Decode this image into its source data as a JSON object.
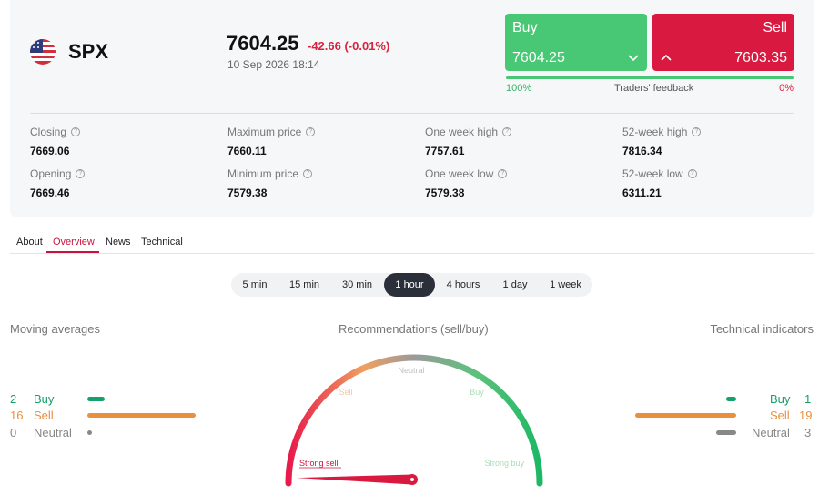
{
  "instrument": {
    "symbol": "SPX",
    "flag_icon": "us-flag-icon",
    "price": "7604.25",
    "change": "-42.66 (-0.01%)",
    "datetime": "10 Sep 2026 18:14"
  },
  "trade": {
    "buy_label": "Buy",
    "buy_price": "7604.25",
    "sell_label": "Sell",
    "sell_price": "7603.35",
    "feedback_buy": "100%",
    "feedback_label": "Traders' feedback",
    "feedback_sell": "0%",
    "feedback_buy_fraction": 1.0
  },
  "stats": [
    {
      "label": "Closing",
      "value": "7669.06"
    },
    {
      "label": "Maximum price",
      "value": "7660.11"
    },
    {
      "label": "One week high",
      "value": "7757.61"
    },
    {
      "label": "52-week high",
      "value": "7816.34"
    },
    {
      "label": "Opening",
      "value": "7669.46"
    },
    {
      "label": "Minimum price",
      "value": "7579.38"
    },
    {
      "label": "One week low",
      "value": "7579.38"
    },
    {
      "label": "52-week low",
      "value": "6311.21"
    }
  ],
  "tabs": [
    "About",
    "Overview",
    "News",
    "Technical"
  ],
  "active_tab": "Overview",
  "periods": [
    "5 min",
    "15 min",
    "30 min",
    "1 hour",
    "4 hours",
    "1 day",
    "1 week"
  ],
  "active_period": "1 hour",
  "moving_averages": {
    "title": "Moving averages",
    "buy_count": "2",
    "buy_label": "Buy",
    "sell_count": "16",
    "sell_label": "Sell",
    "neutral_count": "0",
    "neutral_label": "Neutral"
  },
  "recommendations": {
    "title": "Recommendations (sell/buy)",
    "labels": {
      "strong_sell": "Strong sell",
      "sell": "Sell",
      "neutral": "Neutral",
      "buy": "Buy",
      "strong_buy": "Strong buy"
    },
    "needle_fraction": 0.04
  },
  "technical_indicators": {
    "title": "Technical indicators",
    "buy_count": "1",
    "buy_label": "Buy",
    "sell_count": "19",
    "sell_label": "Sell",
    "neutral_count": "3",
    "neutral_label": "Neutral"
  },
  "colors": {
    "buy": "#48c774",
    "sell": "#d9193f",
    "accent": "#c8143c",
    "ma_green": "#16a06a",
    "ma_orange": "#e8903d"
  }
}
